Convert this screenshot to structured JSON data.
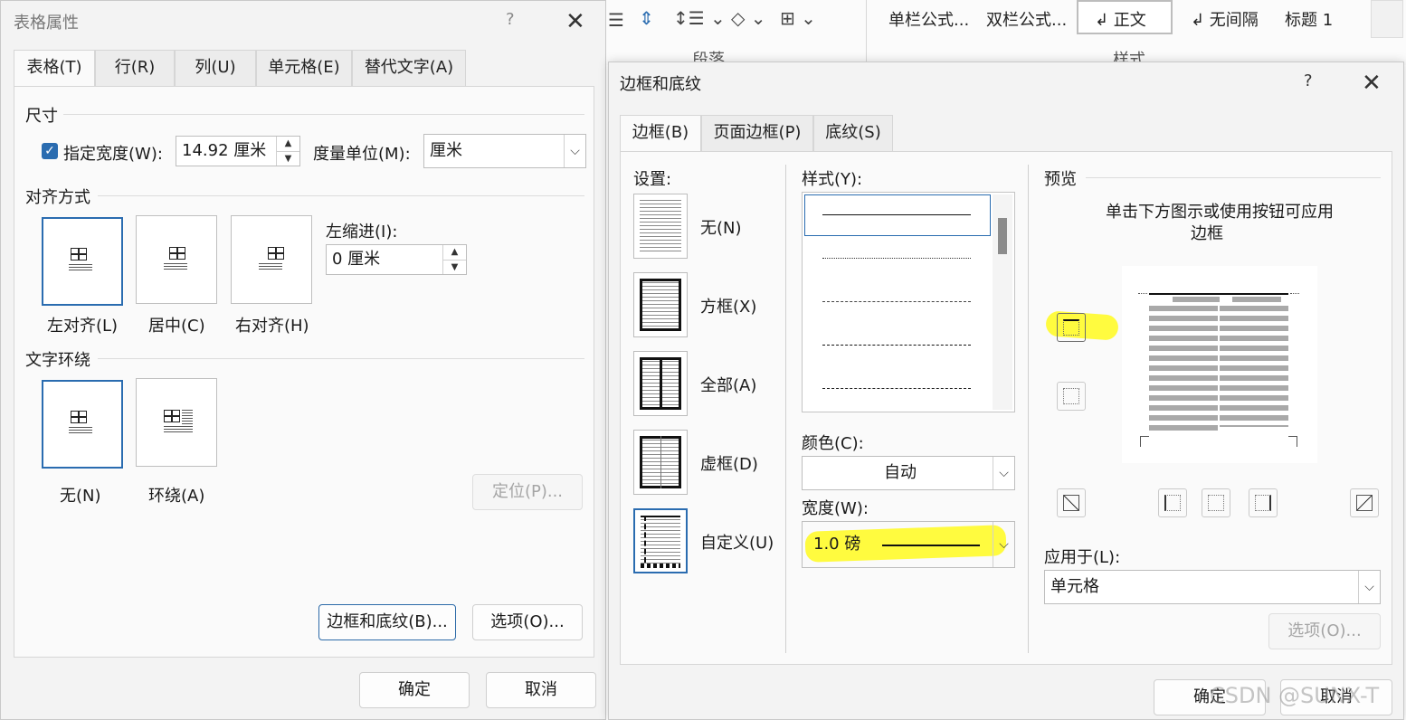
{
  "ribbon": {
    "group_paragraph": "段落",
    "group_styles": "样式",
    "styles": [
      "单栏公式...",
      "双栏公式...",
      "↲ 正文",
      "↲ 无间隔",
      "标题 1"
    ]
  },
  "table_properties": {
    "title": "表格属性",
    "help": "?",
    "close": "✕",
    "tabs": [
      "表格(T)",
      "行(R)",
      "列(U)",
      "单元格(E)",
      "替代文字(A)"
    ],
    "size_label": "尺寸",
    "preferred_width_label": "指定宽度(W):",
    "preferred_width_value": "14.92 厘米",
    "measure_in_label": "度量单位(M):",
    "measure_in_value": "厘米",
    "alignment_label": "对齐方式",
    "align_left": "左对齐(L)",
    "align_center": "居中(C)",
    "align_right": "右对齐(H)",
    "indent_label": "左缩进(I):",
    "indent_value": "0 厘米",
    "wrapping_label": "文字环绕",
    "wrap_none": "无(N)",
    "wrap_around": "环绕(A)",
    "positioning_button": "定位(P)...",
    "borders_button": "边框和底纹(B)...",
    "options_button": "选项(O)...",
    "ok": "确定",
    "cancel": "取消"
  },
  "borders_shading": {
    "title": "边框和底纹",
    "help": "?",
    "close": "✕",
    "tabs": [
      "边框(B)",
      "页面边框(P)",
      "底纹(S)"
    ],
    "setting_label": "设置:",
    "settings": [
      "无(N)",
      "方框(X)",
      "全部(A)",
      "虚框(D)",
      "自定义(U)"
    ],
    "style_label": "样式(Y):",
    "color_label": "颜色(C):",
    "color_value": "自动",
    "width_label": "宽度(W):",
    "width_value": "1.0 磅",
    "preview_label": "预览",
    "preview_hint": [
      "单击下方图示或使用按钮可应用",
      "边框"
    ],
    "apply_to_label": "应用于(L):",
    "apply_to_value": "单元格",
    "options_button": "选项(O)...",
    "ok": "确定",
    "cancel": "取消",
    "watermark": "CSDN @SUNX-T"
  },
  "colors": {
    "accent": "#2a6cb0",
    "highlight": "#fffb2a"
  }
}
